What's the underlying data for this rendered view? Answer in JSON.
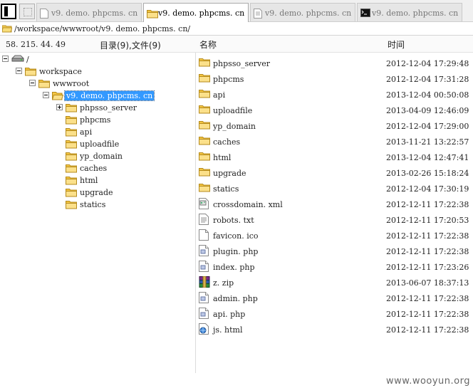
{
  "tabs": [
    {
      "label": "v9. demo. phpcms. cn",
      "icon": "file-icon",
      "active": false
    },
    {
      "label": "v9. demo. phpcms. cn",
      "icon": "folder-icon",
      "active": true
    },
    {
      "label": "v9. demo. phpcms. cn",
      "icon": "document-icon",
      "active": false
    },
    {
      "label": "v9. demo. phpcms. cn",
      "icon": "terminal-icon",
      "active": false
    }
  ],
  "path": "/workspace/wwwroot/v9. demo. phpcms. cn/",
  "header": {
    "ip": "58. 215. 44. 49",
    "summary": "目录(9),文件(9)",
    "col_name": "名称",
    "col_time": "时间"
  },
  "tree": [
    {
      "label": "/",
      "icon": "drive-icon",
      "toggle": "minus",
      "level": 0
    },
    {
      "label": "workspace",
      "icon": "folder-icon",
      "toggle": "minus",
      "level": 1
    },
    {
      "label": "wwwroot",
      "icon": "folder-icon",
      "toggle": "minus",
      "level": 2
    },
    {
      "label": "v9. demo. phpcms. cn",
      "icon": "folder-open-icon",
      "toggle": "minus",
      "level": 3,
      "selected": true
    },
    {
      "label": "phpsso_server",
      "icon": "folder-icon",
      "toggle": "plus",
      "level": 4
    },
    {
      "label": "phpcms",
      "icon": "folder-icon",
      "toggle": "none",
      "level": 4
    },
    {
      "label": "api",
      "icon": "folder-icon",
      "toggle": "none",
      "level": 4
    },
    {
      "label": "uploadfile",
      "icon": "folder-icon",
      "toggle": "none",
      "level": 4
    },
    {
      "label": "yp_domain",
      "icon": "folder-icon",
      "toggle": "none",
      "level": 4
    },
    {
      "label": "caches",
      "icon": "folder-icon",
      "toggle": "none",
      "level": 4
    },
    {
      "label": "html",
      "icon": "folder-icon",
      "toggle": "none",
      "level": 4
    },
    {
      "label": "upgrade",
      "icon": "folder-icon",
      "toggle": "none",
      "level": 4
    },
    {
      "label": "statics",
      "icon": "folder-icon",
      "toggle": "none",
      "level": 4
    }
  ],
  "files": [
    {
      "name": "phpsso_server",
      "time": "2012-12-04 17:29:48",
      "icon": "folder-icon"
    },
    {
      "name": "phpcms",
      "time": "2012-12-04 17:31:28",
      "icon": "folder-icon"
    },
    {
      "name": "api",
      "time": "2013-12-04 00:50:08",
      "icon": "folder-icon"
    },
    {
      "name": "uploadfile",
      "time": "2013-04-09 12:46:09",
      "icon": "folder-icon"
    },
    {
      "name": "yp_domain",
      "time": "2012-12-04 17:29:00",
      "icon": "folder-icon"
    },
    {
      "name": "caches",
      "time": "2013-11-21 13:22:57",
      "icon": "folder-icon"
    },
    {
      "name": "html",
      "time": "2013-12-04 12:47:41",
      "icon": "folder-icon"
    },
    {
      "name": "upgrade",
      "time": "2013-02-26 15:18:24",
      "icon": "folder-icon"
    },
    {
      "name": "statics",
      "time": "2012-12-04 17:30:19",
      "icon": "folder-icon"
    },
    {
      "name": "crossdomain. xml",
      "time": "2012-12-11 17:22:38",
      "icon": "xml-file-icon"
    },
    {
      "name": "robots. txt",
      "time": "2012-12-11 17:20:53",
      "icon": "text-file-icon"
    },
    {
      "name": "favicon. ico",
      "time": "2012-12-11 17:22:38",
      "icon": "blank-file-icon"
    },
    {
      "name": "plugin. php",
      "time": "2012-12-11 17:22:38",
      "icon": "php-file-icon"
    },
    {
      "name": "index. php",
      "time": "2012-12-11 17:23:26",
      "icon": "php-file-icon"
    },
    {
      "name": "z. zip",
      "time": "2013-06-07 18:37:13",
      "icon": "archive-icon"
    },
    {
      "name": "admin. php",
      "time": "2012-12-11 17:22:38",
      "icon": "php-file-icon"
    },
    {
      "name": "api. php",
      "time": "2012-12-11 17:22:38",
      "icon": "php-file-icon"
    },
    {
      "name": "js. html",
      "time": "2012-12-11 17:22:38",
      "icon": "html-file-icon"
    }
  ],
  "watermark": "www.wooyun.org"
}
